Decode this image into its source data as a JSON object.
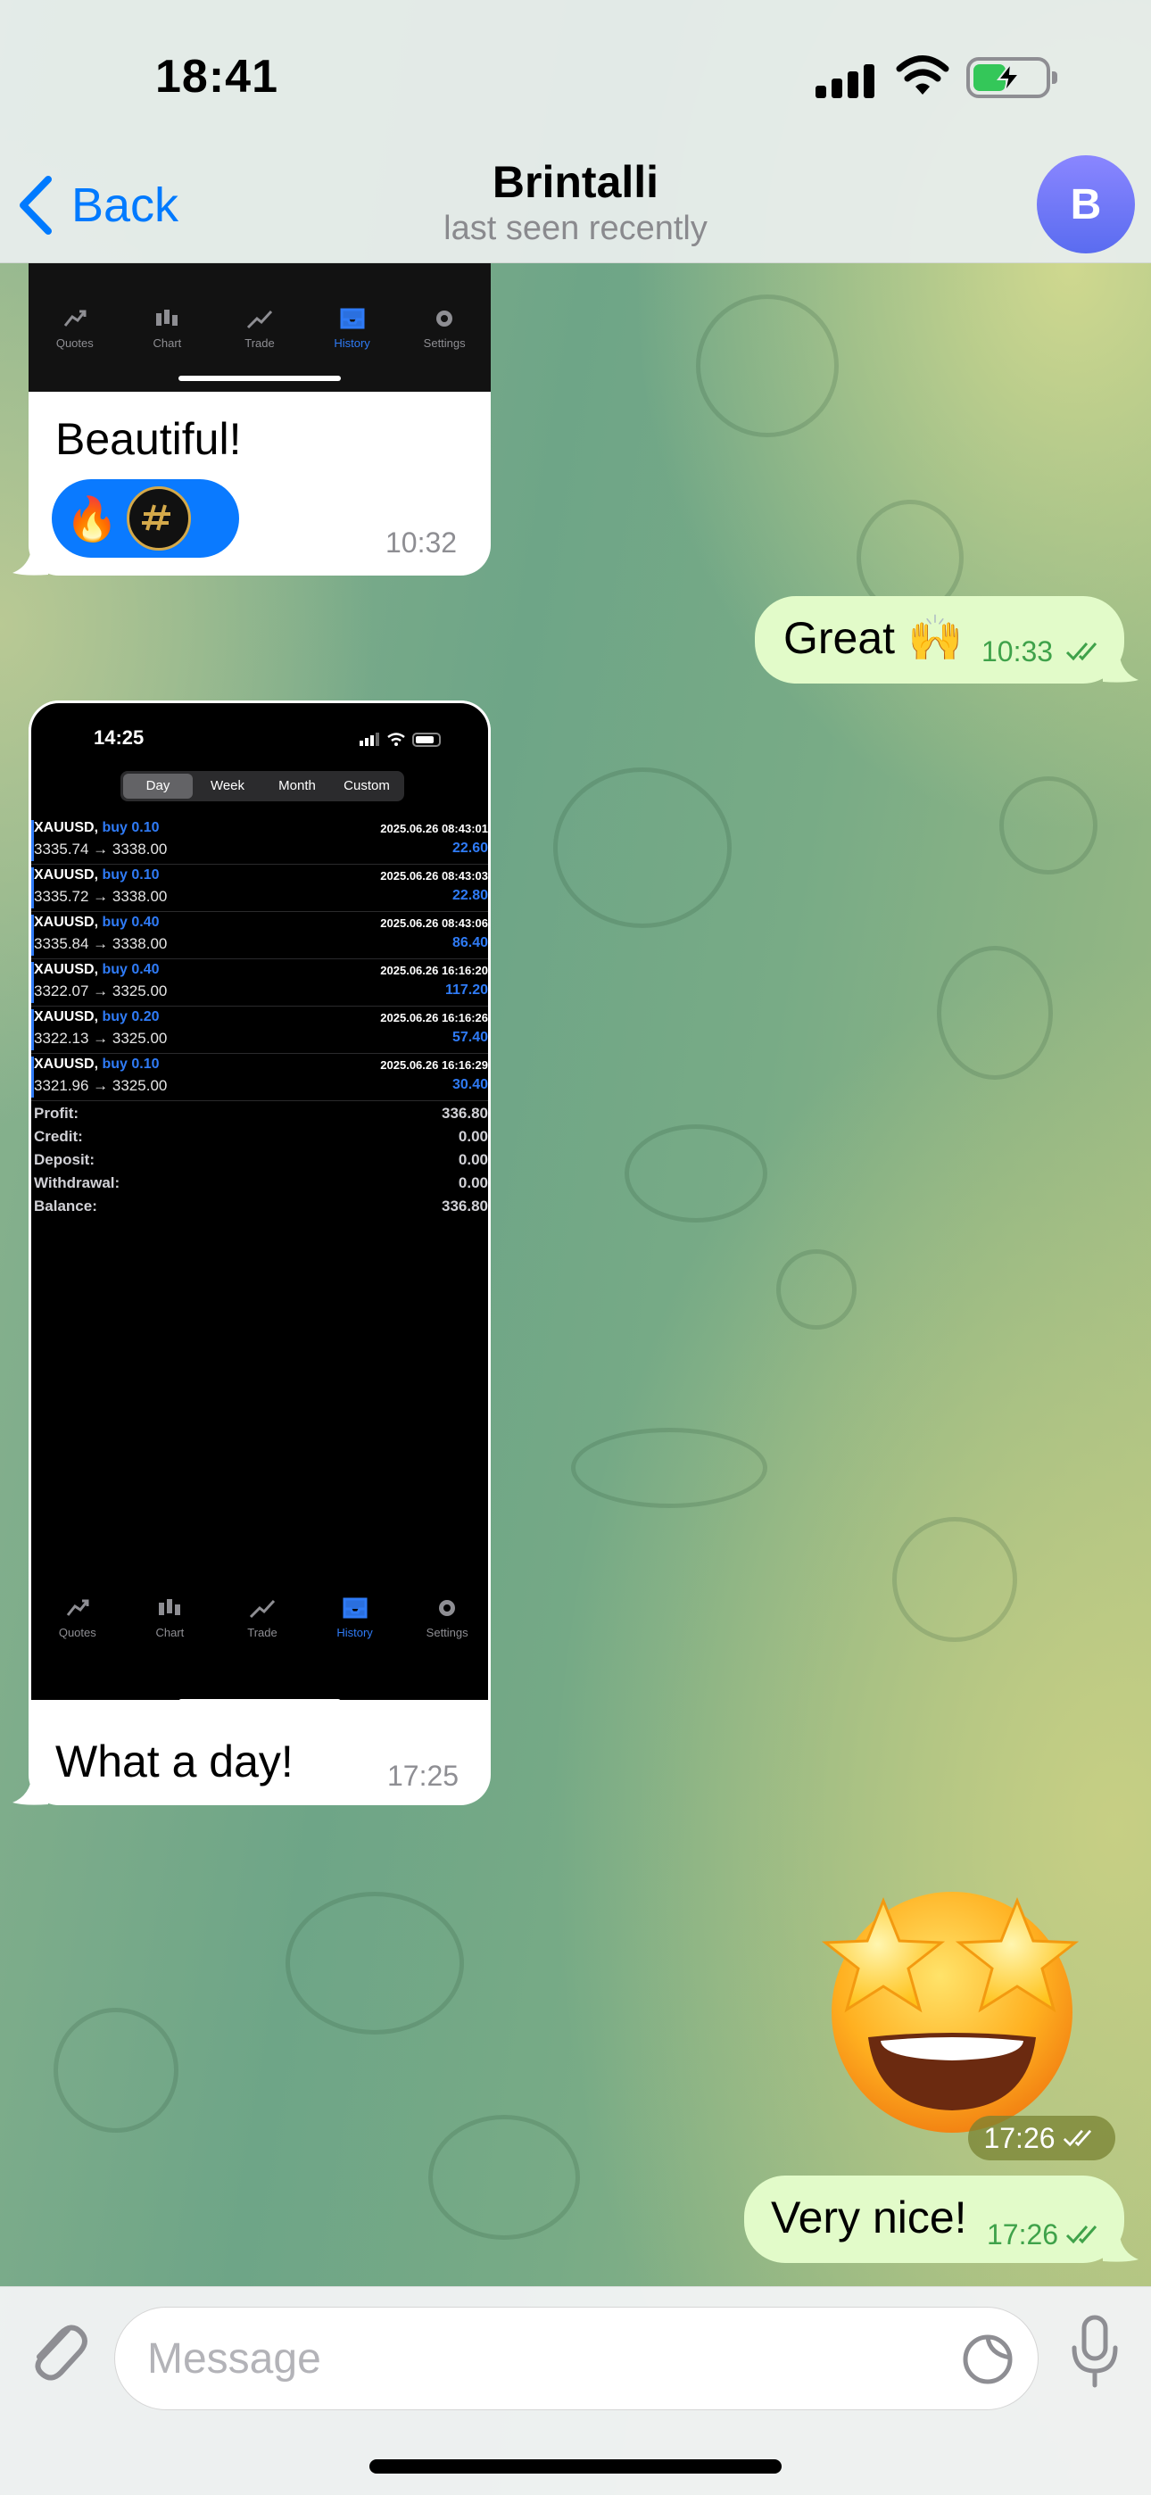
{
  "status": {
    "time": "18:41"
  },
  "header": {
    "back_label": "Back",
    "title": "Brintalli",
    "subtitle": "last seen recently",
    "avatar_letter": "B"
  },
  "messages": {
    "m1": {
      "text": "Beautiful!",
      "time": "10:32"
    },
    "m2": {
      "text": "Great 🙌",
      "time": "10:33"
    },
    "m3": {
      "text": "What a day!",
      "time": "17:25"
    },
    "m4": {
      "time": "17:26"
    },
    "m5": {
      "text": "Very nice!",
      "time": "17:26"
    }
  },
  "reactions": {
    "fire": "🔥"
  },
  "shot_tabs": [
    {
      "label": "Quotes",
      "icon": "quotes-icon"
    },
    {
      "label": "Chart",
      "icon": "chart-icon"
    },
    {
      "label": "Trade",
      "icon": "trade-icon"
    },
    {
      "label": "History",
      "icon": "history-icon",
      "active": true
    },
    {
      "label": "Settings",
      "icon": "settings-icon"
    }
  ],
  "history_screen": {
    "time": "14:25",
    "periods": [
      "Day",
      "Week",
      "Month",
      "Custom"
    ],
    "active_period": "Day",
    "deals": [
      {
        "symbol": "XAUUSD,",
        "side": "buy 0.10",
        "date": "2025.06.26 08:43:01",
        "prices": "3335.74 → 3338.00",
        "profit": "22.60"
      },
      {
        "symbol": "XAUUSD,",
        "side": "buy 0.10",
        "date": "2025.06.26 08:43:03",
        "prices": "3335.72 → 3338.00",
        "profit": "22.80"
      },
      {
        "symbol": "XAUUSD,",
        "side": "buy 0.40",
        "date": "2025.06.26 08:43:06",
        "prices": "3335.84 → 3338.00",
        "profit": "86.40"
      },
      {
        "symbol": "XAUUSD,",
        "side": "buy 0.40",
        "date": "2025.06.26 16:16:20",
        "prices": "3322.07 → 3325.00",
        "profit": "117.20"
      },
      {
        "symbol": "XAUUSD,",
        "side": "buy 0.20",
        "date": "2025.06.26 16:16:26",
        "prices": "3322.13 → 3325.00",
        "profit": "57.40"
      },
      {
        "symbol": "XAUUSD,",
        "side": "buy 0.10",
        "date": "2025.06.26 16:16:29",
        "prices": "3321.96 → 3325.00",
        "profit": "30.40"
      }
    ],
    "summary": [
      {
        "label": "Profit:",
        "value": "336.80"
      },
      {
        "label": "Credit:",
        "value": "0.00"
      },
      {
        "label": "Deposit:",
        "value": "0.00"
      },
      {
        "label": "Withdrawal:",
        "value": "0.00"
      },
      {
        "label": "Balance:",
        "value": "336.80"
      }
    ]
  },
  "composer": {
    "placeholder": "Message"
  },
  "colors": {
    "accent": "#007aff",
    "outgoing_bubble": "#e2fbc9",
    "read_check": "#3fa24a",
    "mt_blue": "#2f7bf6"
  }
}
